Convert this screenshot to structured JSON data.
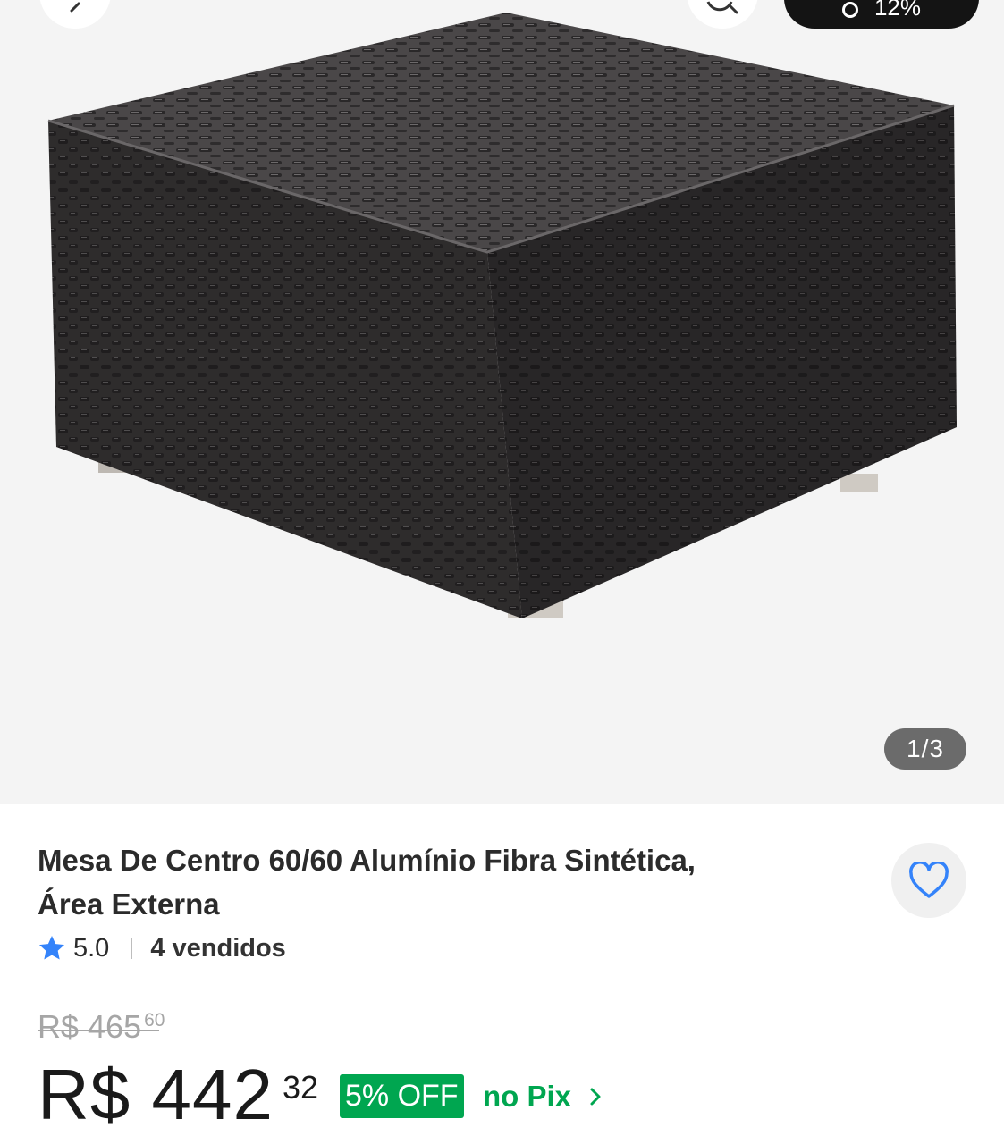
{
  "header": {
    "back_icon": "chevron-left-icon",
    "search_icon": "search-icon",
    "cart_badge": "12%",
    "cart_icon": "cart-icon"
  },
  "gallery": {
    "image_subject": "product-photo-woven-table",
    "counter": "1/3"
  },
  "product": {
    "title_line1": "Mesa De Centro 60/60 Alumínio Fibra Sintética,",
    "title_line2": "Área Externa",
    "rating": "5.0",
    "sold": "4 vendidos",
    "favorite_icon": "heart-icon"
  },
  "pricing": {
    "old_price_main": "R$ 465",
    "old_price_cents": "60",
    "price_main": "R$ 442",
    "price_cents": "32",
    "discount_badge": "5% OFF",
    "pix_label": "no Pix"
  },
  "colors": {
    "accent_green": "#00a650",
    "favorite_blue": "#3483fa",
    "gallery_bg": "#f4f4f4"
  }
}
